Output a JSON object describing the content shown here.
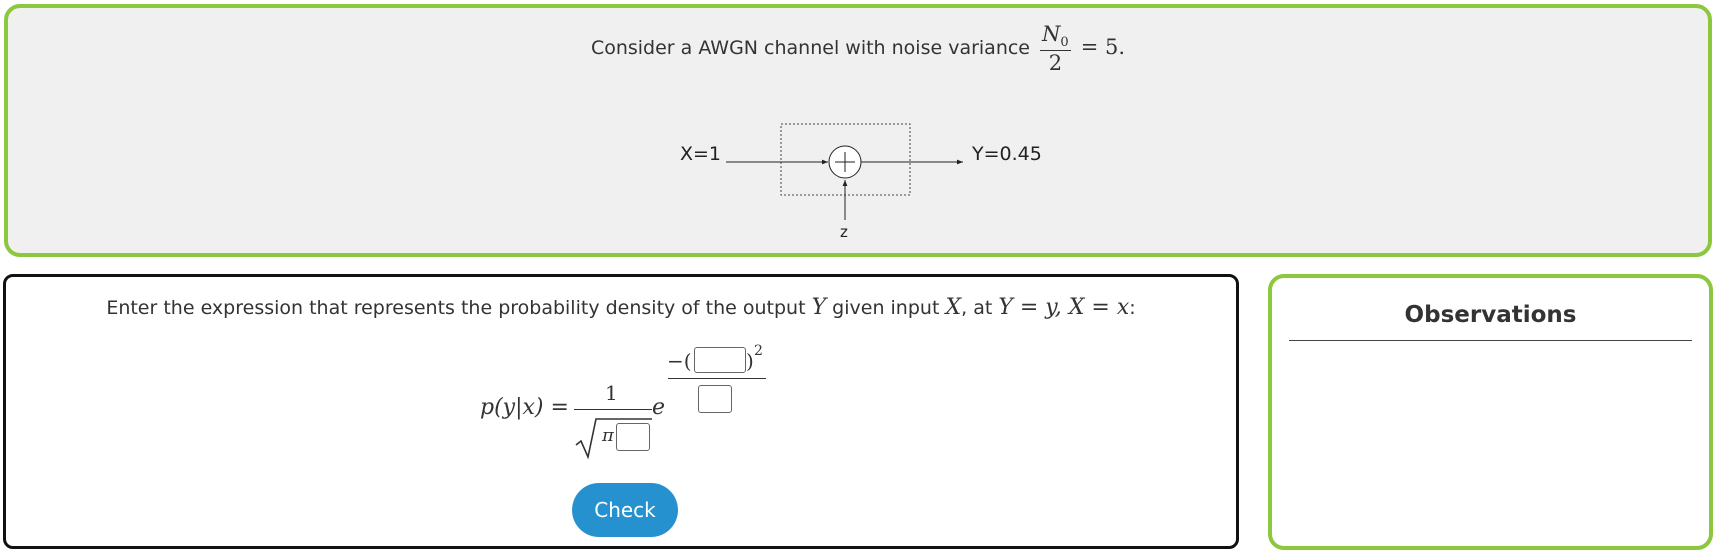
{
  "problem": {
    "intro_text": "Consider a AWGN channel with noise variance",
    "fraction_numerator": "N",
    "fraction_numerator_sub": "0",
    "fraction_denominator": "2",
    "equals_value": "= 5."
  },
  "diagram": {
    "input_label": "X=1",
    "output_label": "Y=0.45",
    "noise_label": "z"
  },
  "question": {
    "text_1": "Enter the expression that represents the probability density of the output",
    "var_Y": "Y",
    "text_2": "given input",
    "var_X": "X",
    "text_3": ", at",
    "condition": "Y = y, X = x",
    "text_4": ":"
  },
  "formula": {
    "lhs": "p(y|x) =",
    "numerator": "1",
    "pi": "π",
    "e": "e",
    "exp_minus": "−(",
    "exp_close": ")",
    "exp_power": "2",
    "answer_boxes": [
      {
        "name": "exponent-numerator-input",
        "value": ""
      },
      {
        "name": "exponent-denominator-input",
        "value": ""
      },
      {
        "name": "sqrt-input",
        "value": ""
      }
    ]
  },
  "buttons": {
    "check_label": "Check"
  },
  "observations": {
    "title": "Observations"
  },
  "colors": {
    "panel_border": "#8dc63f",
    "button": "#2691cf"
  }
}
